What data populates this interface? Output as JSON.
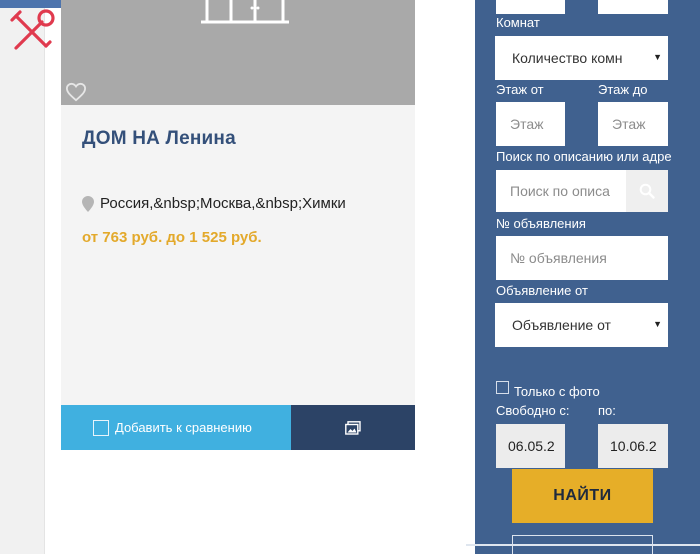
{
  "colors": {
    "panel_bg": "#40618f",
    "accent_yellow": "#e3a92b",
    "compare_blue": "#40b0e0",
    "dark_navy": "#2c4366",
    "title_blue": "#34507a",
    "tools_red": "#e03a4e"
  },
  "card": {
    "title": "ДОМ НА Ленина",
    "location": "Россия,&nbsp;Москва,&nbsp;Химки",
    "price": "от 763 руб. до 1 525 руб.",
    "compare_label": "Добавить к сравнению",
    "icons": {
      "favorite": "heart-icon",
      "location": "map-pin-icon",
      "gallery": "gallery-icon",
      "tools": "tools-icon"
    }
  },
  "filters": {
    "rooms_label": "Комнат",
    "rooms_value": "Количество комн",
    "floor_from_label": "Этаж от",
    "floor_to_label": "Этаж до",
    "floor_from_placeholder": "Этаж",
    "floor_to_placeholder": "Этаж",
    "search_label": "Поиск по описанию или адре",
    "search_placeholder": "Поиск по описа",
    "ad_number_label": "№ объявления",
    "ad_number_placeholder": "№ объявления",
    "ad_from_label": "Объявление от",
    "ad_from_value": "Объявление от",
    "photo_only_label": "Только с фото",
    "free_from_label": "Свободно с:",
    "free_to_label": "по:",
    "date_from": "06.05.2",
    "date_to": "10.06.2",
    "find_button": "НАЙТИ"
  }
}
